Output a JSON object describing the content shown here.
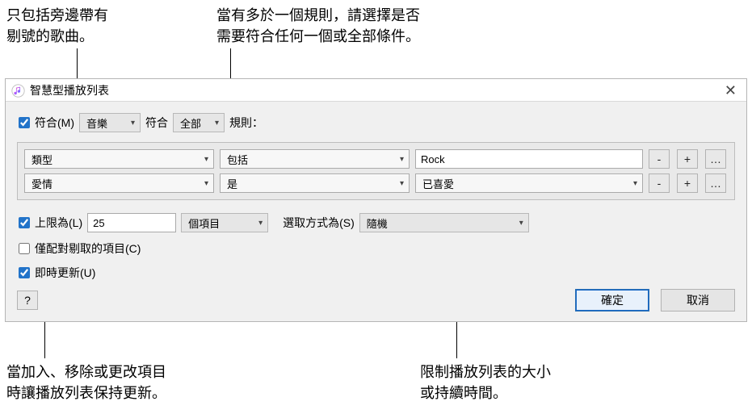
{
  "callouts": {
    "top_left": "只包括旁邊帶有\n剔號的歌曲。",
    "top_right": "當有多於一個規則，請選擇是否\n需要符合任何一個或全部條件。",
    "bottom_left": "當加入、移除或更改項目\n時讓播放列表保持更新。",
    "bottom_right": "限制播放列表的大小\n或持續時間。"
  },
  "window": {
    "title": "智慧型播放列表",
    "close_glyph": "✕"
  },
  "match": {
    "checked": true,
    "label": "符合(M)",
    "media": "音樂",
    "word_match": "符合",
    "scope": "全部",
    "suffix": "規則："
  },
  "rules": [
    {
      "field": "類型",
      "op": "包括",
      "value": "Rock",
      "value_type": "text",
      "minus": "-",
      "plus": "+",
      "more": "…"
    },
    {
      "field": "愛情",
      "op": "是",
      "value": "已喜愛",
      "value_type": "select",
      "minus": "-",
      "plus": "+",
      "more": "…"
    }
  ],
  "limit": {
    "checked": true,
    "label": "上限為(L)",
    "value": "25",
    "unit": "個項目",
    "selected_by_label": "選取方式為(S)",
    "method": "隨機"
  },
  "checkedOnly": {
    "checked": false,
    "label": "僅配對剔取的項目(C)"
  },
  "liveUpdate": {
    "checked": true,
    "label": "即時更新(U)"
  },
  "buttons": {
    "help": "?",
    "ok": "確定",
    "cancel": "取消"
  }
}
